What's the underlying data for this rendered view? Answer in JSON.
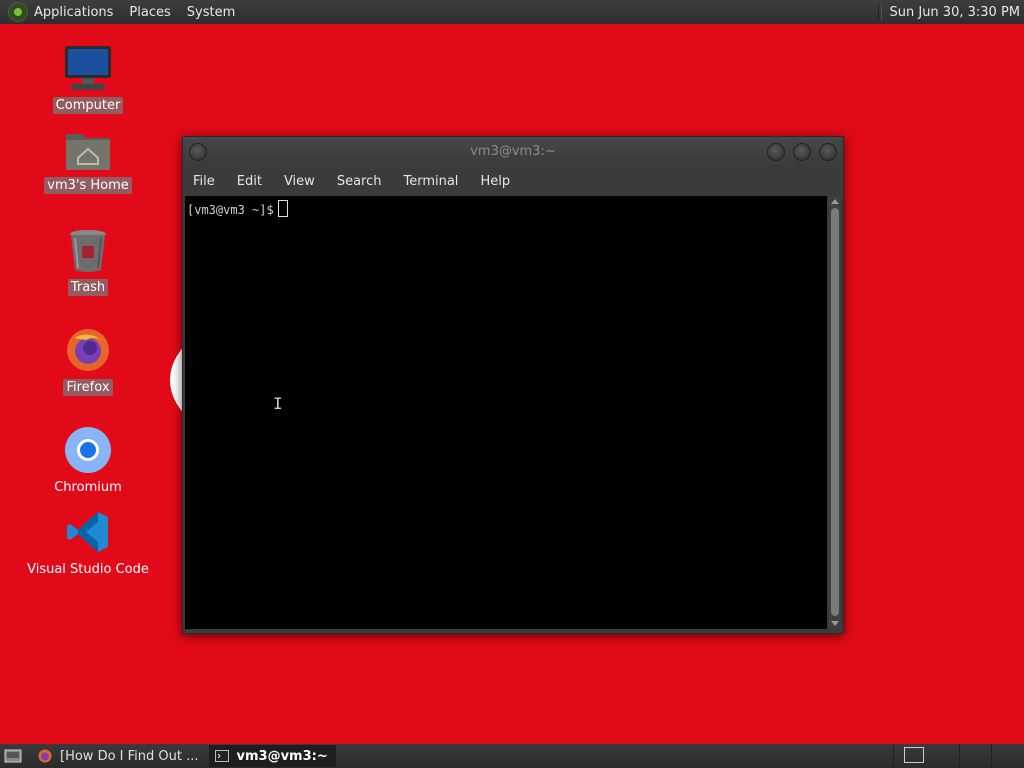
{
  "top_panel": {
    "menus": [
      "Applications",
      "Places",
      "System"
    ],
    "clock": "Sun Jun 30,  3:30 PM"
  },
  "desktop_icons": [
    {
      "label": "Computer",
      "icon": "computer-icon",
      "selected": true
    },
    {
      "label": "vm3's Home",
      "icon": "home-folder-icon",
      "selected": true
    },
    {
      "label": "Trash",
      "icon": "trash-icon",
      "selected": true
    },
    {
      "label": "Firefox",
      "icon": "firefox-icon",
      "selected": true
    },
    {
      "label": "Chromium",
      "icon": "chromium-icon",
      "selected": false
    },
    {
      "label": "Visual Studio Code",
      "icon": "vscode-icon",
      "selected": false
    }
  ],
  "terminal": {
    "title": "vm3@vm3:~",
    "menu": [
      "File",
      "Edit",
      "View",
      "Search",
      "Terminal",
      "Help"
    ],
    "prompt": "[vm3@vm3 ~]$"
  },
  "taskbar": {
    "tasks": [
      {
        "label": "[How Do I Find Out ...",
        "icon": "firefox-icon",
        "active": false
      },
      {
        "label": "vm3@vm3:~",
        "icon": "terminal-icon",
        "active": true
      }
    ]
  },
  "colors": {
    "desktop_bg": "#e20a18",
    "panel_bg": "#333333",
    "terminal_bg": "#000000"
  }
}
